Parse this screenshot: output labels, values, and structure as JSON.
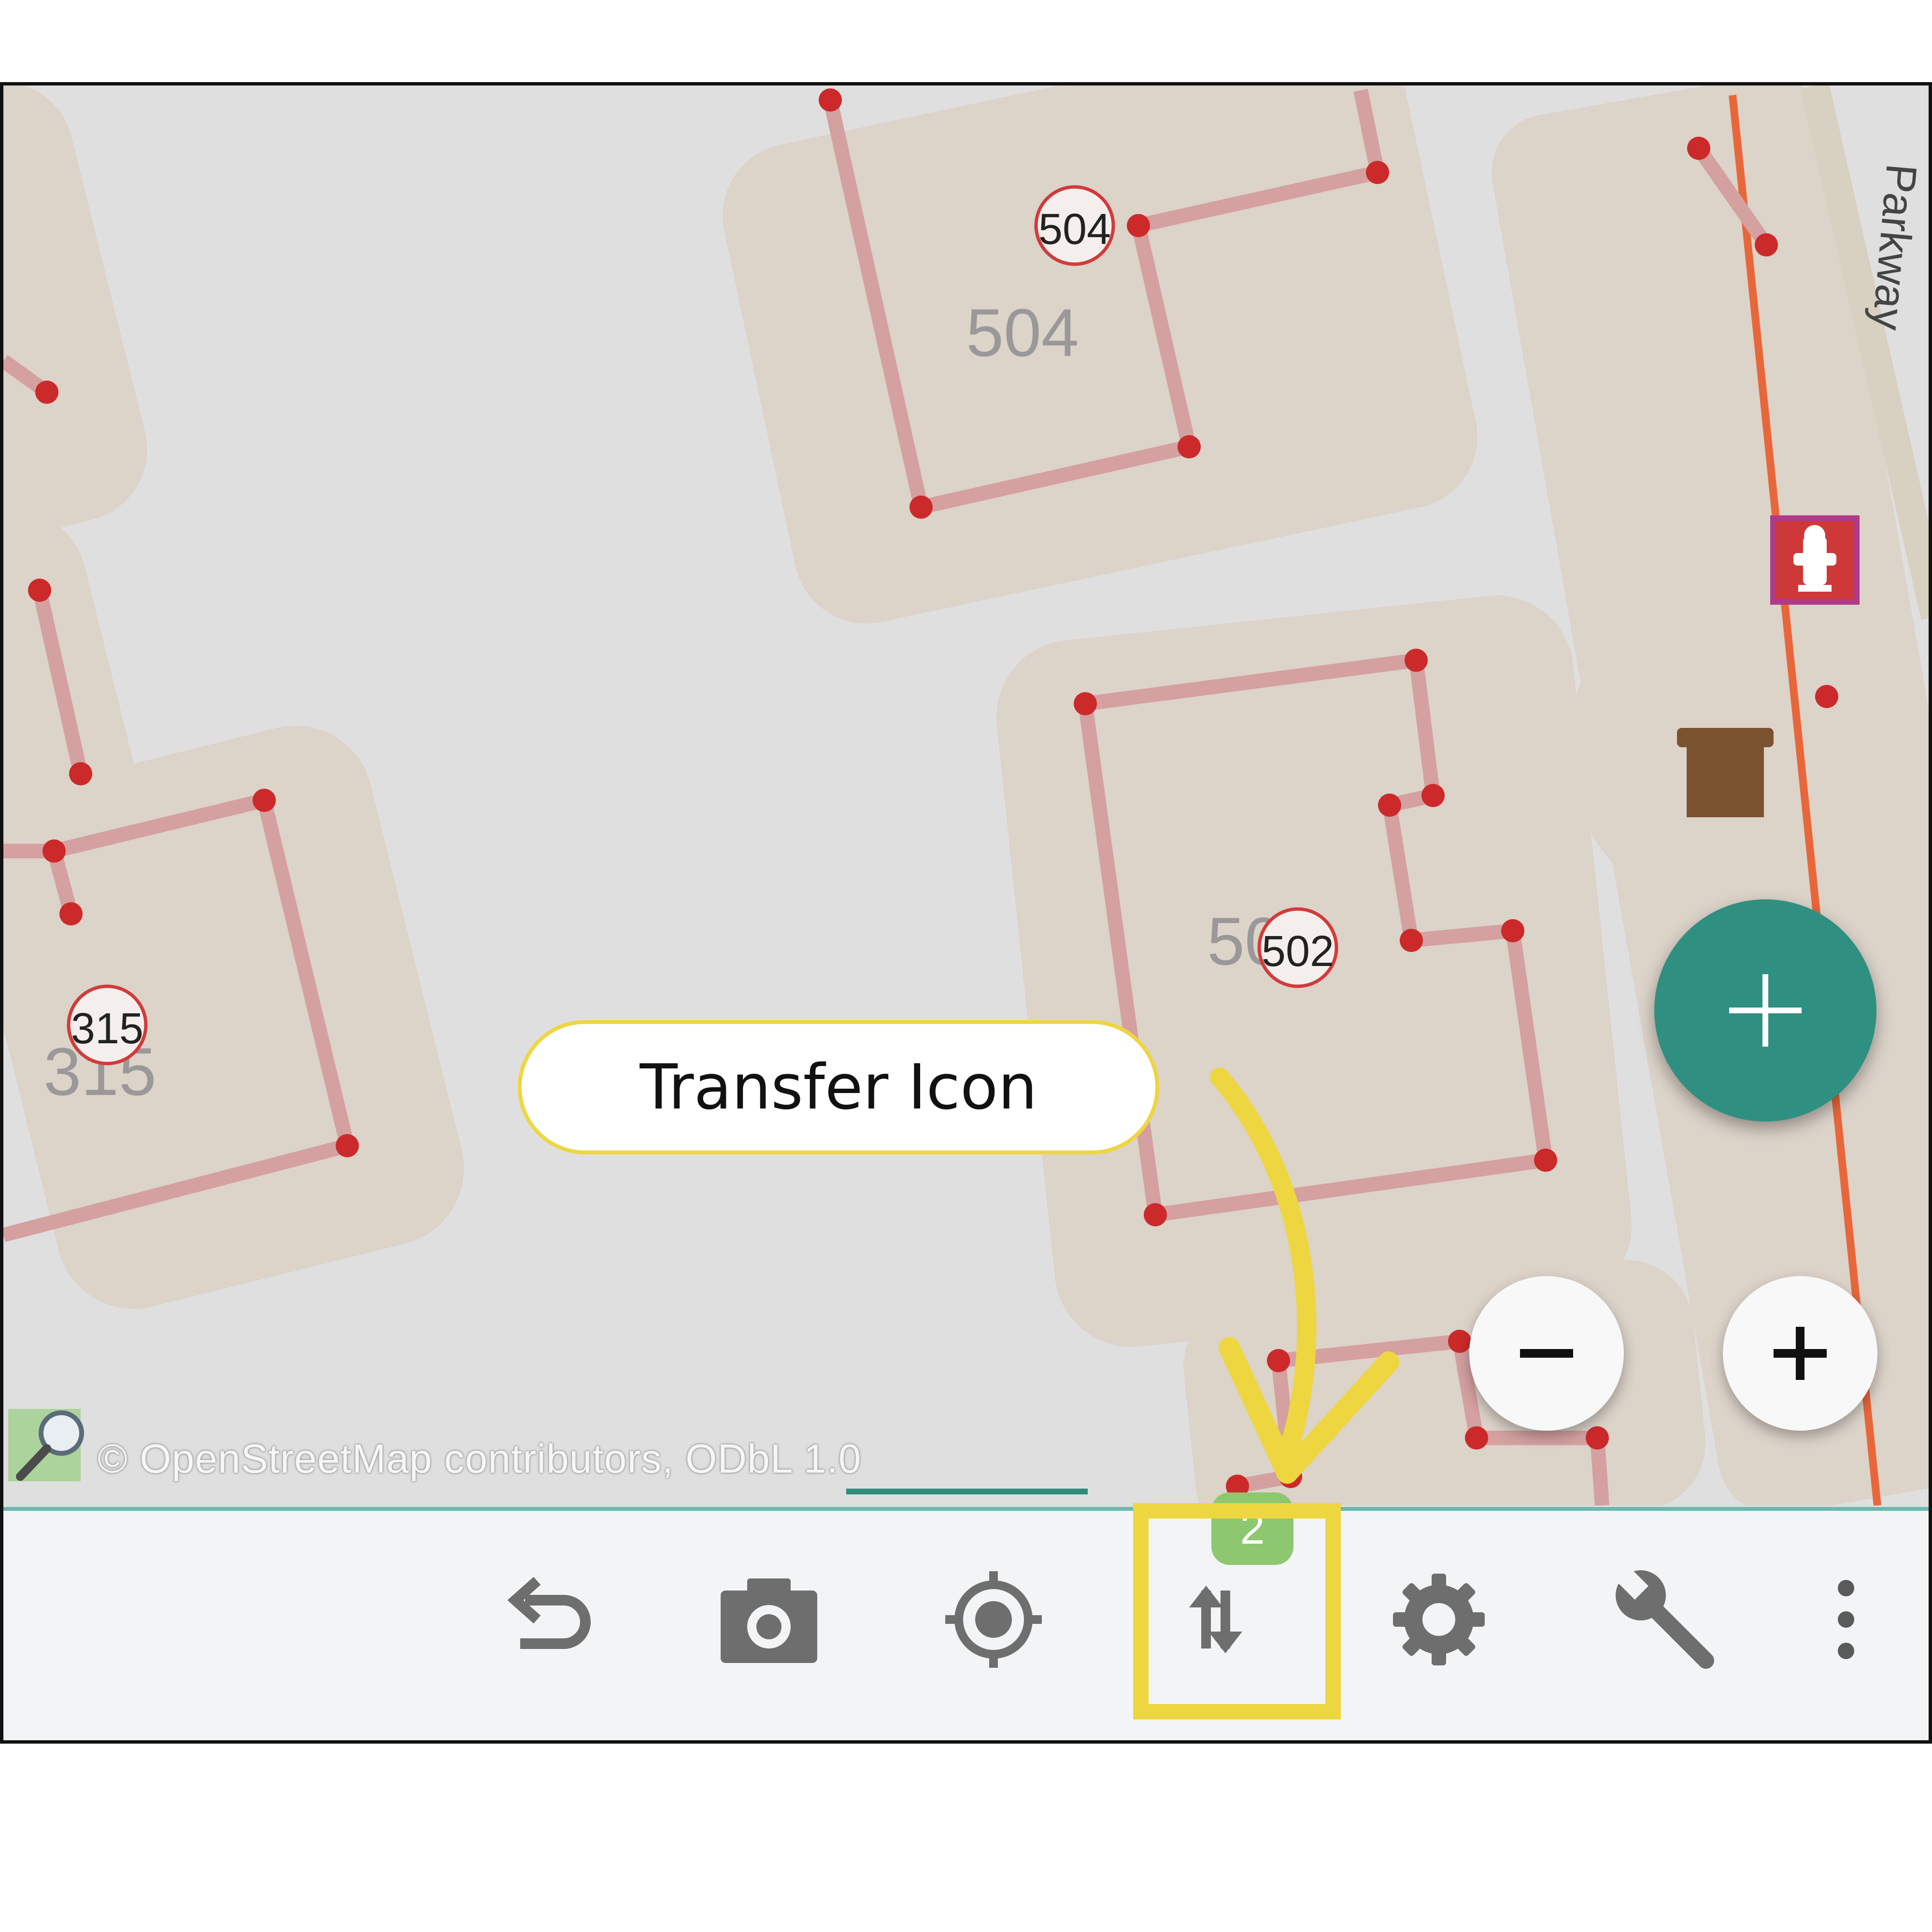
{
  "map": {
    "house_numbers": [
      {
        "id": "504-badge",
        "text": "504"
      },
      {
        "id": "504-label",
        "text": "504"
      },
      {
        "id": "502-badge",
        "text": "502"
      },
      {
        "id": "502-label",
        "text": "50"
      },
      {
        "id": "315-badge",
        "text": "315"
      },
      {
        "id": "315-label",
        "text": "315"
      }
    ],
    "street_label": "Parkway",
    "attribution": "© OpenStreetMap contributors, ODbL 1.0"
  },
  "controls": {
    "fab_add": "+",
    "zoom_out": "−",
    "zoom_in": "+"
  },
  "toolbar": {
    "items": [
      {
        "name": "undo",
        "icon": "undo-icon"
      },
      {
        "name": "camera",
        "icon": "camera-icon"
      },
      {
        "name": "gps",
        "icon": "gps-locate-icon"
      },
      {
        "name": "transfer",
        "icon": "transfer-icon",
        "badge": "2"
      },
      {
        "name": "preferences",
        "icon": "gear-icon"
      },
      {
        "name": "tools",
        "icon": "wrench-icon"
      },
      {
        "name": "overflow",
        "icon": "more-vert-icon"
      }
    ]
  },
  "annotation": {
    "callout_text": "Transfer Icon",
    "highlight_color": "#eed640"
  },
  "colors": {
    "map_background": "#e0dfe0",
    "building_outline": "#d4a0a0",
    "node": "#cc2a2a",
    "fab": "#2f8f80",
    "badge": "#8dc770",
    "road": "#e8673a"
  }
}
